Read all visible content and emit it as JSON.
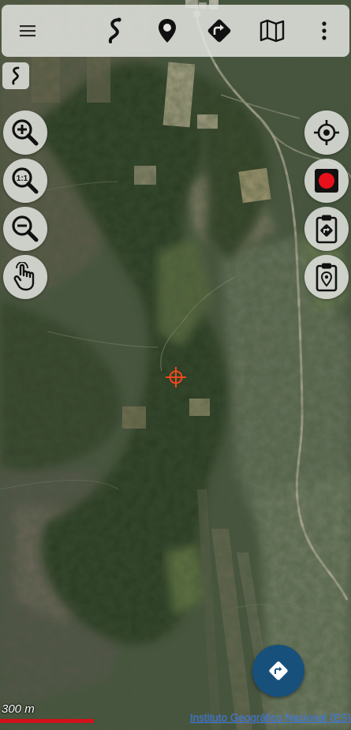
{
  "map": {
    "type": "satellite",
    "scale_label": "300 m",
    "attribution": "Instituto Geográfico Nacional (ES)"
  },
  "toolbar": {
    "items": [
      {
        "icon": "menu-icon"
      },
      {
        "icon": "track-icon"
      },
      {
        "icon": "waypoint-icon"
      },
      {
        "icon": "route-icon"
      },
      {
        "icon": "map-icon"
      },
      {
        "icon": "more-vert-icon"
      }
    ]
  },
  "left_controls": [
    {
      "icon": "track-small-icon"
    },
    {
      "icon": "zoom-in-icon"
    },
    {
      "icon": "zoom-1to1-icon",
      "label": "1:1"
    },
    {
      "icon": "zoom-out-icon"
    },
    {
      "icon": "touch-icon"
    }
  ],
  "right_controls": [
    {
      "icon": "locate-icon"
    },
    {
      "icon": "record-icon"
    },
    {
      "icon": "clipboard-route-icon"
    },
    {
      "icon": "clipboard-waypoint-icon"
    }
  ],
  "colors": {
    "record": "#e8101a",
    "crosshair": "#ff4a1c",
    "fab": "#18507c",
    "scale_bar": "#d4101a",
    "attribution_link": "#2f6fe0"
  }
}
